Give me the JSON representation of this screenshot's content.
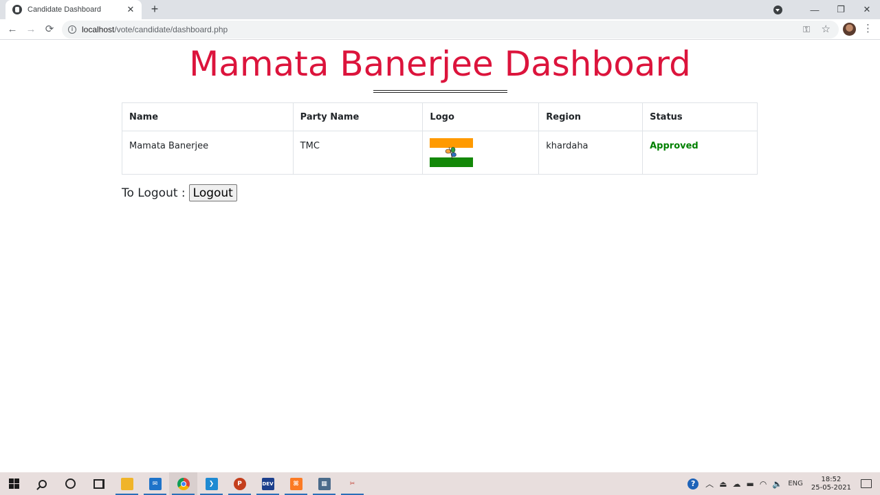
{
  "browser": {
    "tab_title": "Candidate Dashboard",
    "tab_close": "✕",
    "new_tab": "+",
    "url_host": "localhost",
    "url_path": "/vote/candidate/dashboard.php",
    "window_buttons": {
      "minimize": "—",
      "maximize": "❐",
      "close": "✕"
    }
  },
  "page": {
    "title": "Mamata Banerjee Dashboard",
    "title_color": "#dc143c"
  },
  "table": {
    "headers": [
      "Name",
      "Party Name",
      "Logo",
      "Region",
      "Status"
    ],
    "rows": [
      {
        "name": "Mamata Banerjee",
        "party": "TMC",
        "logo": "party-flag-logo",
        "region": "khardaha",
        "status": "Approved",
        "status_color": "#008000"
      }
    ]
  },
  "logout": {
    "label": "To Logout :",
    "button": "Logout"
  },
  "taskbar": {
    "apps": [
      "start-icon",
      "search-icon",
      "cortana-icon",
      "task-view-icon",
      "file-explorer-icon",
      "mail-icon",
      "chrome-icon",
      "vscode-icon",
      "powerpoint-icon",
      "dev-cpp-icon",
      "xampp-icon",
      "calculator-icon",
      "snipping-tool-icon"
    ],
    "language": "ENG",
    "time": "18:52",
    "date": "25-05-2021"
  }
}
